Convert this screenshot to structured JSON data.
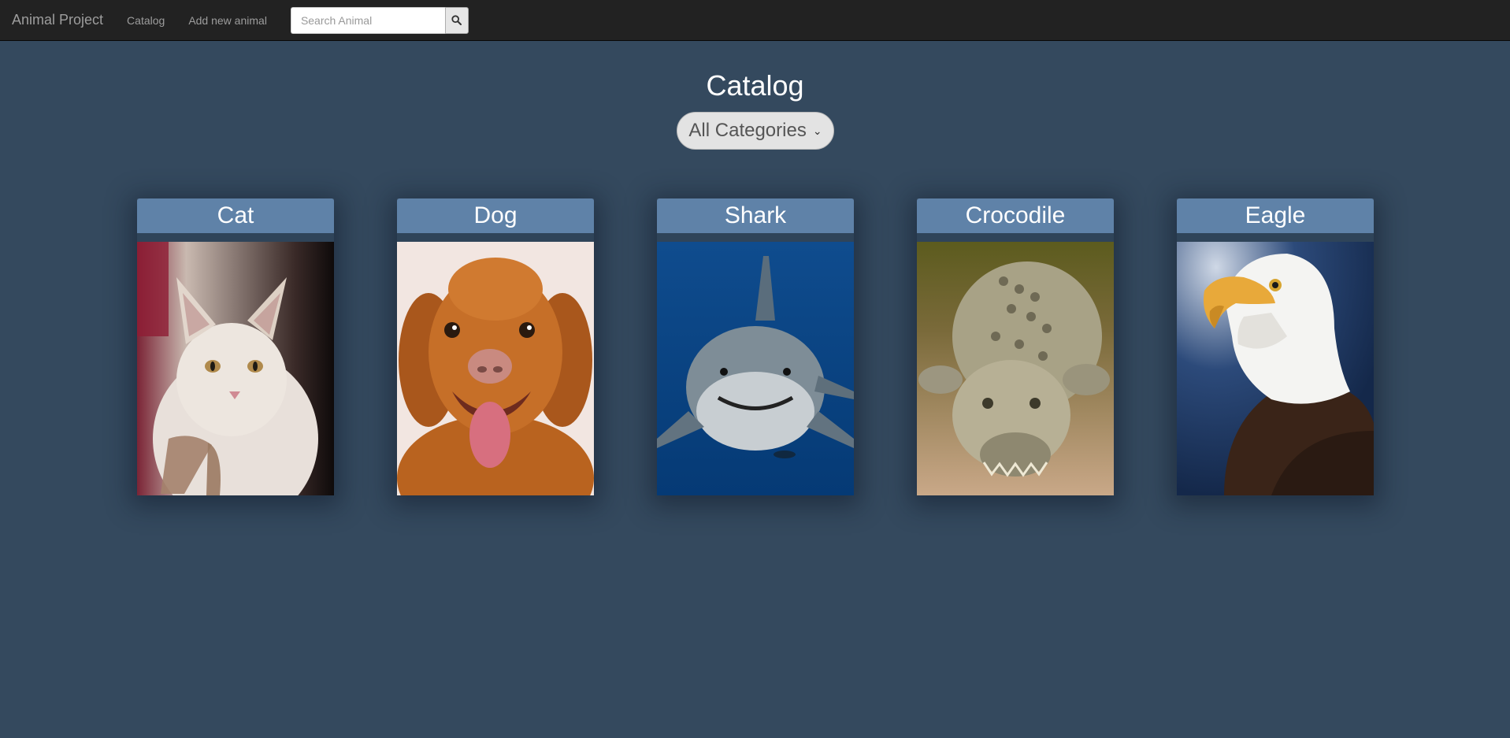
{
  "navbar": {
    "brand": "Animal Project",
    "links": [
      {
        "label": "Catalog"
      },
      {
        "label": "Add new animal"
      }
    ],
    "search": {
      "placeholder": "Search Animal",
      "value": "",
      "button_icon": "search-icon"
    }
  },
  "main": {
    "title": "Catalog",
    "category_select": {
      "selected": "All Categories"
    }
  },
  "animals": [
    {
      "name": "Cat"
    },
    {
      "name": "Dog"
    },
    {
      "name": "Shark"
    },
    {
      "name": "Crocodile"
    },
    {
      "name": "Eagle"
    }
  ],
  "colors": {
    "background": "#34495e",
    "navbar": "#222222",
    "card_header": "#5f82a8"
  }
}
